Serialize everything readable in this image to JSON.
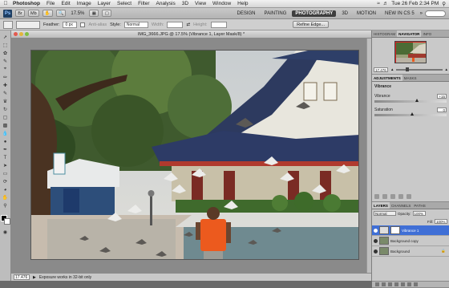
{
  "menubar": {
    "app": "Photoshop",
    "items": [
      "File",
      "Edit",
      "Image",
      "Layer",
      "Select",
      "Filter",
      "Analysis",
      "3D",
      "View",
      "Window",
      "Help"
    ],
    "clock": "Tue 26 Feb 2:34 PM"
  },
  "appbar": {
    "logo": "Ps",
    "zoom": "17.5%",
    "workspaces": [
      "DESIGN",
      "PAINTING",
      "PHOTOGRAPHY",
      "3D",
      "MOTION",
      "NEW IN CS 5"
    ],
    "active_workspace": "PHOTOGRAPHY"
  },
  "options": {
    "feather_label": "Feather:",
    "feather_value": "0 px",
    "antialias_label": "Anti-alias",
    "style_label": "Style:",
    "style_value": "Normal",
    "width_label": "Width:",
    "height_label": "Height:",
    "refine_label": "Refine Edge..."
  },
  "document": {
    "title": "IMG_3666.JPG @ 17.5% (Vibrance 1, Layer Mask/8) *",
    "zoom": "17.476",
    "status": "Exposure works in 32-bit only"
  },
  "navigator": {
    "tabs": [
      "HISTOGRAM",
      "NAVIGATOR",
      "INFO"
    ],
    "active_tab": "NAVIGATOR",
    "zoom": "17.476"
  },
  "adjustments": {
    "tabs": [
      "ADJUSTMENTS",
      "MASKS"
    ],
    "active_tab": "ADJUSTMENTS",
    "title": "Vibrance",
    "rows": [
      {
        "label": "Vibrance",
        "value": "+15",
        "level": 0.57
      },
      {
        "label": "Saturation",
        "value": "0",
        "level": 0.5
      }
    ]
  },
  "layers": {
    "tabs": [
      "LAYERS",
      "CHANNELS",
      "PATHS"
    ],
    "active_tab": "LAYERS",
    "blend_mode": "Normal",
    "opacity_label": "Opacity:",
    "opacity_value": "100%",
    "fill_label": "Fill:",
    "fill_value": "100%",
    "items": [
      {
        "name": "Vibrance 1",
        "selected": true
      },
      {
        "name": "Background copy",
        "selected": false
      },
      {
        "name": "Background",
        "selected": false
      }
    ]
  },
  "colors": {
    "selection": "#3f6fd6",
    "active_workspace": "#3e3e3e",
    "nav_frame": "#e02020"
  }
}
